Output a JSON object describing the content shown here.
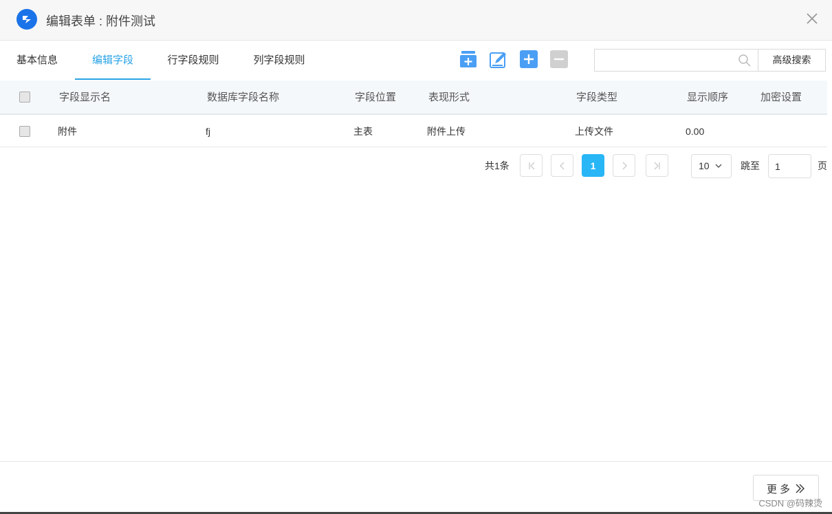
{
  "dialog": {
    "title": "编辑表单 : 附件测试",
    "logo_icon": "app-logo-icon",
    "close_icon": "close-icon"
  },
  "tabs": [
    {
      "label": "基本信息",
      "active": false
    },
    {
      "label": "编辑字段",
      "active": true
    },
    {
      "label": "行字段规则",
      "active": false
    },
    {
      "label": "列字段规则",
      "active": false
    }
  ],
  "toolbar": {
    "icons": [
      "add-table-icon",
      "edit-icon",
      "add-icon",
      "remove-icon"
    ],
    "accent_color": "#4a9ff5",
    "disabled_color": "#d0d0d0"
  },
  "search": {
    "placeholder": "",
    "value": "",
    "advanced_label": "高级搜索"
  },
  "table": {
    "headers": [
      "字段显示名",
      "数据库字段名称",
      "字段位置",
      "表现形式",
      "字段类型",
      "显示顺序",
      "加密设置"
    ],
    "rows": [
      {
        "display_name": "附件",
        "db_name": "fj",
        "position": "主表",
        "form": "附件上传",
        "type": "上传文件",
        "order": "0.00",
        "encrypt": ""
      }
    ]
  },
  "pagination": {
    "total": "共1条",
    "current_page": "1",
    "page_size": "10",
    "jump_label": "跳至",
    "jump_value": "1",
    "page_unit": "页",
    "active_color": "#29b6f6"
  },
  "footer": {
    "more_label": "更多",
    "watermark": "CSDN @码辣烫"
  }
}
